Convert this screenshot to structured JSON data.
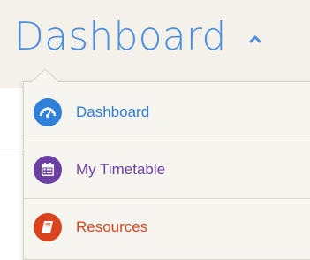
{
  "header": {
    "title": "Dashboard",
    "caret_icon": "chevron-up-icon"
  },
  "menu": {
    "items": [
      {
        "label": "Dashboard",
        "icon": "speedometer-icon",
        "color": "#2f80d8"
      },
      {
        "label": "My Timetable",
        "icon": "calendar-icon",
        "color": "#6d3fa5"
      },
      {
        "label": "Resources",
        "icon": "book-icon",
        "color": "#d9431e"
      }
    ]
  },
  "colors": {
    "header_bg": "#f4f1ea",
    "title": "#4a8fe0",
    "menu_bg": "#f7f5ef"
  }
}
